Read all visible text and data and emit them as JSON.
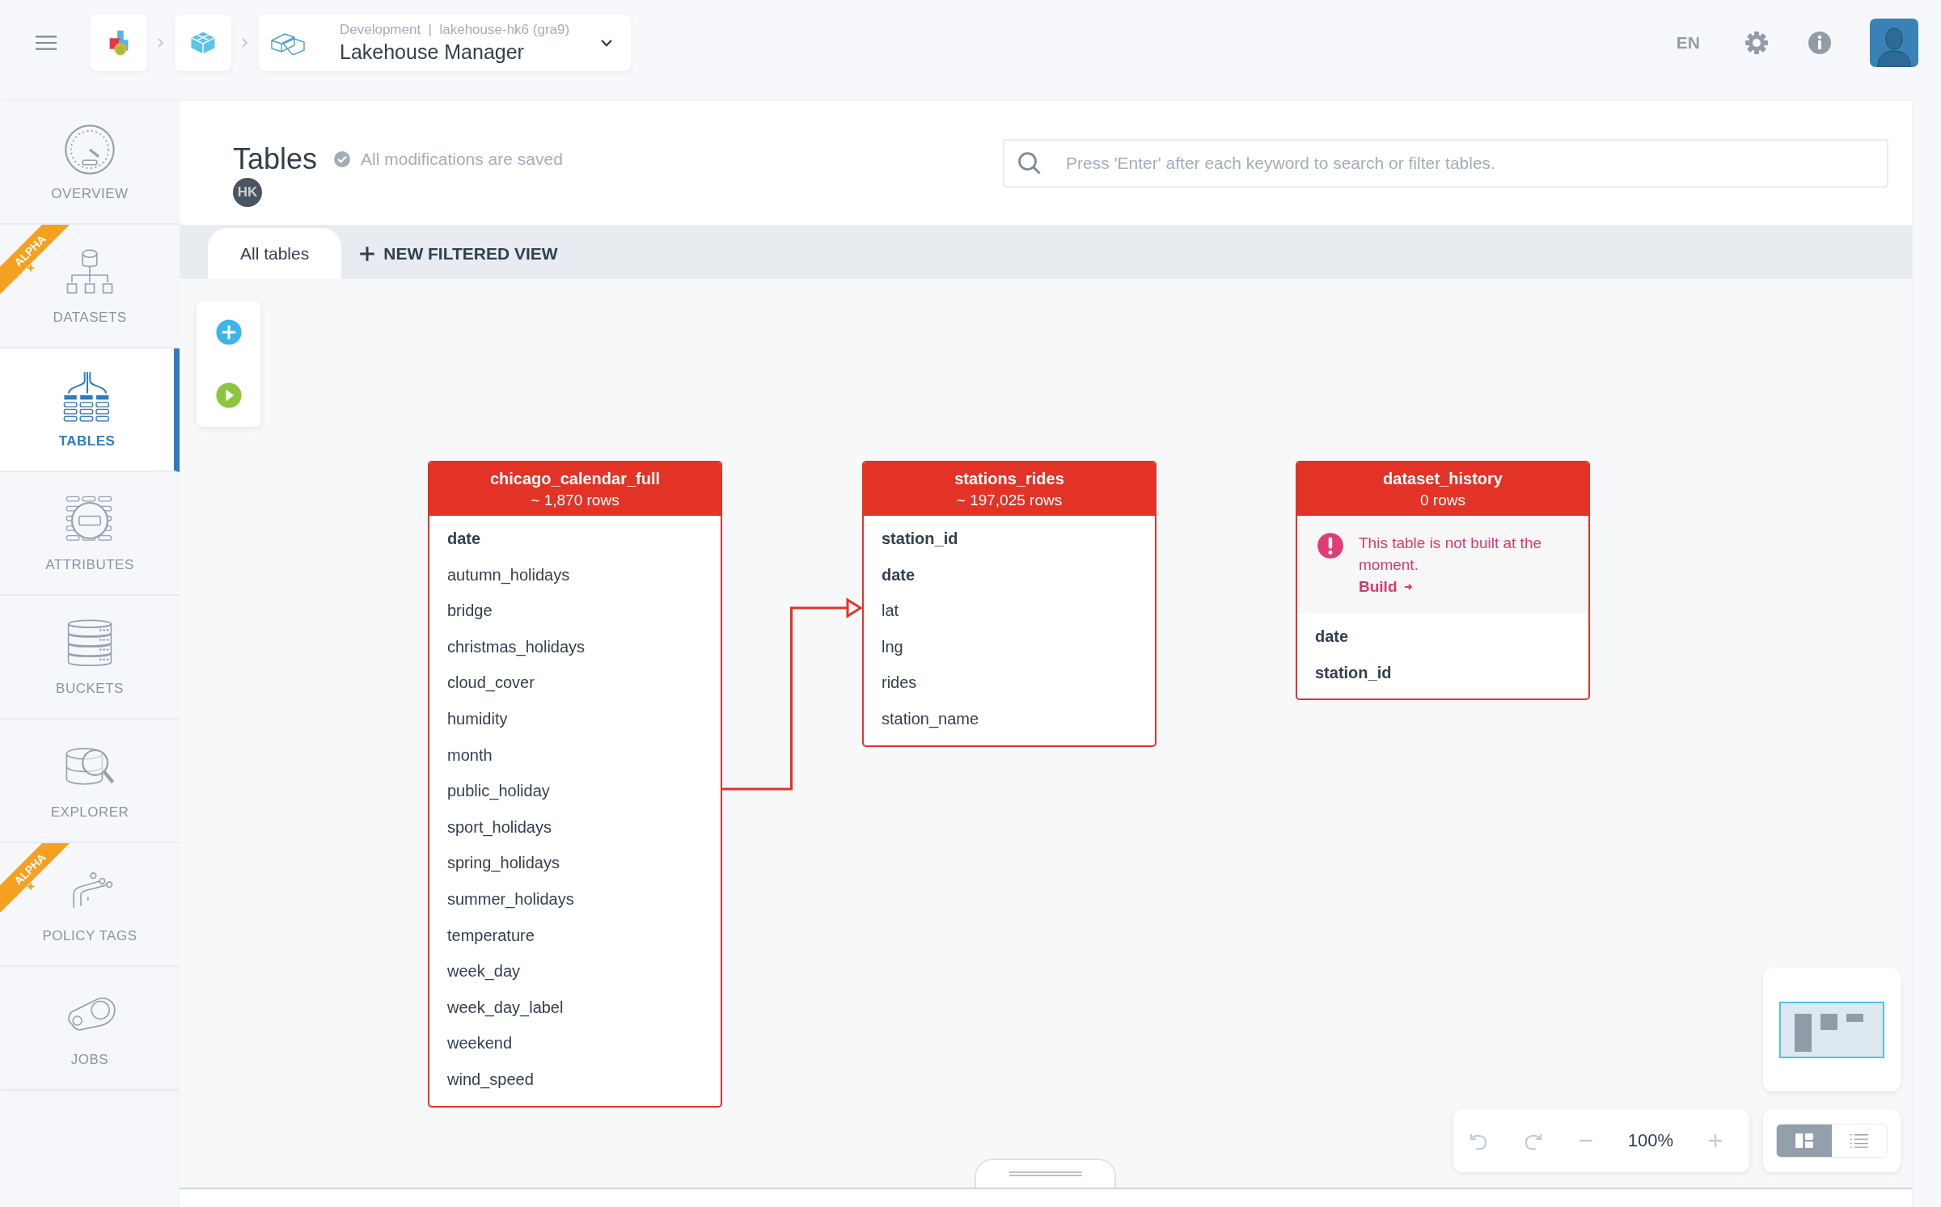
{
  "breadcrumb": {
    "environment": "Development",
    "separator": "|",
    "project": "lakehouse-hk6 (gra9)",
    "title": "Lakehouse Manager"
  },
  "language": "EN",
  "sidebar": {
    "items": [
      {
        "label": "OVERVIEW",
        "selected": false
      },
      {
        "label": "DATASETS",
        "selected": false,
        "badge": "ALPHA"
      },
      {
        "label": "TABLES",
        "selected": true
      },
      {
        "label": "ATTRIBUTES",
        "selected": false
      },
      {
        "label": "BUCKETS",
        "selected": false
      },
      {
        "label": "EXPLORER",
        "selected": false
      },
      {
        "label": "POLICY TAGS",
        "selected": false,
        "badge": "ALPHA"
      },
      {
        "label": "JOBS",
        "selected": false
      }
    ]
  },
  "page": {
    "title": "Tables",
    "save_status": "All modifications are saved",
    "user_initials": "HK"
  },
  "search": {
    "placeholder": "Press 'Enter' after each keyword to search or filter tables."
  },
  "tabs": [
    {
      "label": "All tables",
      "selected": true,
      "kind": "tab"
    },
    {
      "label": "NEW FILTERED VIEW",
      "selected": false,
      "kind": "add"
    }
  ],
  "tables": [
    {
      "name": "chicago_calendar_full",
      "rows": "~ 1,870 rows",
      "fields": [
        {
          "name": "date",
          "primary": true
        },
        {
          "name": "autumn_holidays",
          "primary": false
        },
        {
          "name": "bridge",
          "primary": false
        },
        {
          "name": "christmas_holidays",
          "primary": false
        },
        {
          "name": "cloud_cover",
          "primary": false
        },
        {
          "name": "humidity",
          "primary": false
        },
        {
          "name": "month",
          "primary": false
        },
        {
          "name": "public_holiday",
          "primary": false
        },
        {
          "name": "sport_holidays",
          "primary": false
        },
        {
          "name": "spring_holidays",
          "primary": false
        },
        {
          "name": "summer_holidays",
          "primary": false
        },
        {
          "name": "temperature",
          "primary": false
        },
        {
          "name": "week_day",
          "primary": false
        },
        {
          "name": "week_day_label",
          "primary": false
        },
        {
          "name": "weekend",
          "primary": false
        },
        {
          "name": "wind_speed",
          "primary": false
        }
      ]
    },
    {
      "name": "stations_rides",
      "rows": "~ 197,025 rows",
      "fields": [
        {
          "name": "station_id",
          "primary": true
        },
        {
          "name": "date",
          "primary": true
        },
        {
          "name": "lat",
          "primary": false
        },
        {
          "name": "lng",
          "primary": false
        },
        {
          "name": "rides",
          "primary": false
        },
        {
          "name": "station_name",
          "primary": false
        }
      ]
    },
    {
      "name": "dataset_history",
      "rows": "0 rows",
      "warning": {
        "message": "This table is not built at the moment.",
        "action": "Build"
      },
      "fields": [
        {
          "name": "date",
          "primary": true
        },
        {
          "name": "station_id",
          "primary": true
        }
      ]
    }
  ],
  "zoom": "100%",
  "view_modes": [
    {
      "kind": "diagram",
      "selected": true
    },
    {
      "kind": "list",
      "selected": false
    }
  ]
}
